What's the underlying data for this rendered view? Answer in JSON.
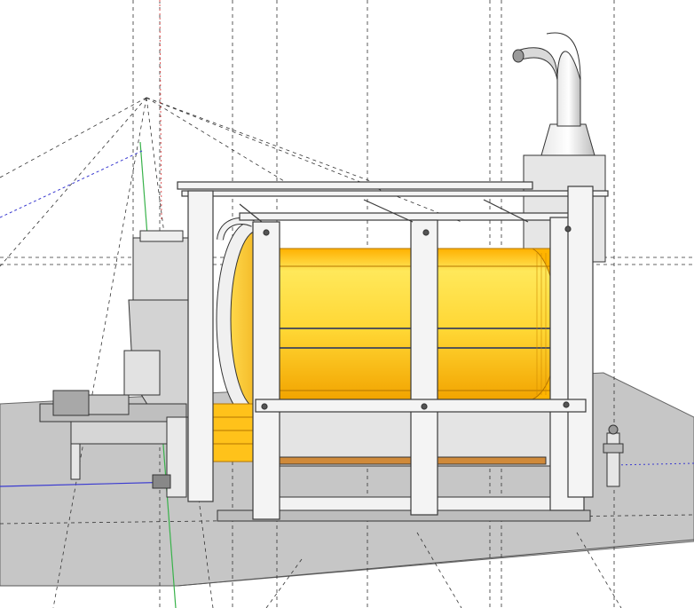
{
  "scene": {
    "subject": "industrial-drum-machine-3d-model",
    "colors": {
      "background": "#ffffff",
      "ground": "#c6c6c6",
      "ground_edge": "#6a6a6a",
      "frame": "#f4f4f4",
      "frame_stroke": "#3a3a3a",
      "drum_light": "#ffe24a",
      "drum_mid": "#ffc61a",
      "drum_dark": "#f0a000",
      "drum_rim": "#d98a00",
      "steel": "#d9d9d9",
      "steel_dark": "#9a9a9a",
      "axis_red": "#e05555",
      "axis_green": "#38b24a",
      "axis_blue": "#3a3ad0",
      "guide_line": "#333333"
    }
  }
}
